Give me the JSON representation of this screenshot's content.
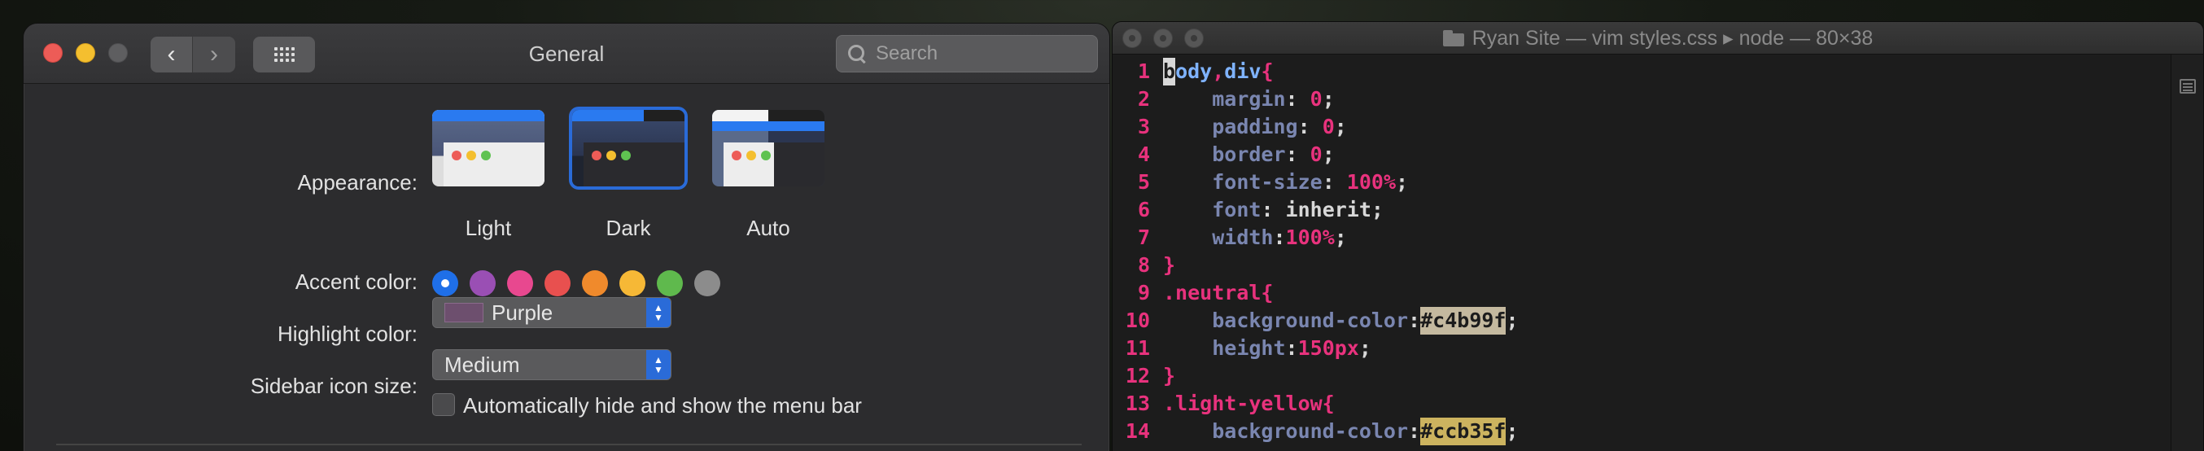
{
  "prefs": {
    "title": "General",
    "search_placeholder": "Search",
    "appearance": {
      "label": "Appearance:",
      "options": [
        "Light",
        "Dark",
        "Auto"
      ],
      "selected": "Dark"
    },
    "accent": {
      "label": "Accent color:",
      "colors": [
        "#1f6fe8",
        "#9a4fb4",
        "#e8488f",
        "#e8504f",
        "#f08a2c",
        "#f6b836",
        "#5fb94d",
        "#8c8c8c"
      ],
      "selected_index": 0
    },
    "highlight": {
      "label": "Highlight color:",
      "value": "Purple",
      "chip_color": "#6d4f6e"
    },
    "sidebar_icon": {
      "label": "Sidebar icon size:",
      "value": "Medium"
    },
    "menubar_checkbox": {
      "label": "Automatically hide and show the menu bar",
      "checked": false
    }
  },
  "terminal": {
    "title": "Ryan Site — vim styles.css ▸ node — 80×38",
    "lines": [
      {
        "n": "1"
      },
      {
        "n": "2"
      },
      {
        "n": "3"
      },
      {
        "n": "4"
      },
      {
        "n": "5"
      },
      {
        "n": "6"
      },
      {
        "n": "7"
      },
      {
        "n": "8"
      },
      {
        "n": "9"
      },
      {
        "n": "10"
      },
      {
        "n": "11"
      },
      {
        "n": "12"
      },
      {
        "n": "13"
      },
      {
        "n": "14"
      }
    ],
    "tokens": {
      "l1_cursor": "b",
      "l1_a": "ody",
      "l1_b": ",",
      "l1_c": "div",
      "l1_d": "{",
      "l2_prop": "margin",
      "l2_colon": ": ",
      "l2_val": "0",
      "l2_end": ";",
      "l3_prop": "padding",
      "l3_colon": ": ",
      "l3_val": "0",
      "l3_end": ";",
      "l4_prop": "border",
      "l4_colon": ": ",
      "l4_val": "0",
      "l4_end": ";",
      "l5_prop": "font-size",
      "l5_colon": ": ",
      "l5_val": "100",
      "l5_pct": "%",
      "l5_end": ";",
      "l6_prop": "font",
      "l6_colon": ": ",
      "l6_val": "inherit",
      "l6_end": ";",
      "l7_prop": "width",
      "l7_colon": ":",
      "l7_val": "100",
      "l7_pct": "%",
      "l7_end": ";",
      "l8": "}",
      "l9": ".neutral{",
      "l10_prop": "background-color",
      "l10_colon": ":",
      "l10_val": "#c4b99f",
      "l10_end": ";",
      "l11_prop": "height",
      "l11_colon": ":",
      "l11_val": "150px",
      "l11_end": ";",
      "l12": "}",
      "l13": ".light-yellow{",
      "l14_prop": "background-color",
      "l14_colon": ":",
      "l14_val": "#ccb35f",
      "l14_end": ";"
    }
  }
}
